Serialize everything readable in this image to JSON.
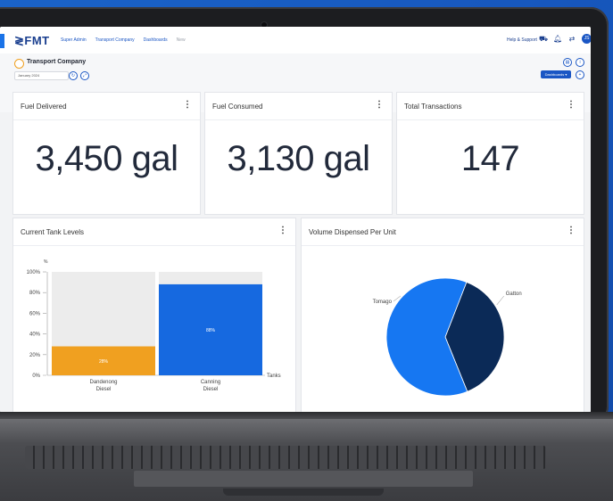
{
  "nav": {
    "logo": "≷FMT",
    "breadcrumbs": [
      "Super Admin",
      "Transport Company",
      "Dashboards",
      "New"
    ],
    "help_label": "Help & Support",
    "avatar_initials": "JS"
  },
  "subheader": {
    "company_name": "Transport Company",
    "date_value": "January 2024",
    "dashboards_button": "Dashboards ▾"
  },
  "kpis": [
    {
      "title": "Fuel Delivered",
      "value": "3,450 gal"
    },
    {
      "title": "Fuel Consumed",
      "value": "3,130 gal"
    },
    {
      "title": "Total Transactions",
      "value": "147"
    }
  ],
  "tank_chart": {
    "title": "Current Tank Levels"
  },
  "pie_chart": {
    "title": "Volume Dispensed Per Unit"
  },
  "chart_data": [
    {
      "type": "bar",
      "title": "Current Tank Levels",
      "ylabel": "%",
      "xlabel": "Tanks",
      "categories": [
        "Dandenong Diesel",
        "Canning Diesel"
      ],
      "category_lines": [
        [
          "Dandenong",
          "Diesel"
        ],
        [
          "Canning",
          "Diesel"
        ]
      ],
      "values": [
        28,
        88
      ],
      "value_labels": [
        "28%",
        "88%"
      ],
      "colors": [
        "#f0a020",
        "#1669e0"
      ],
      "ylim": [
        0,
        100
      ],
      "yticks": [
        0,
        20,
        40,
        60,
        80,
        100
      ],
      "ytick_labels": [
        "0%",
        "20%",
        "40%",
        "60%",
        "80%",
        "100%"
      ]
    },
    {
      "type": "pie",
      "title": "Volume Dispensed Per Unit",
      "labels": [
        "Gatton",
        "Tomago"
      ],
      "values": [
        38,
        62
      ],
      "colors": [
        "#0b2a57",
        "#1677f2"
      ]
    }
  ]
}
